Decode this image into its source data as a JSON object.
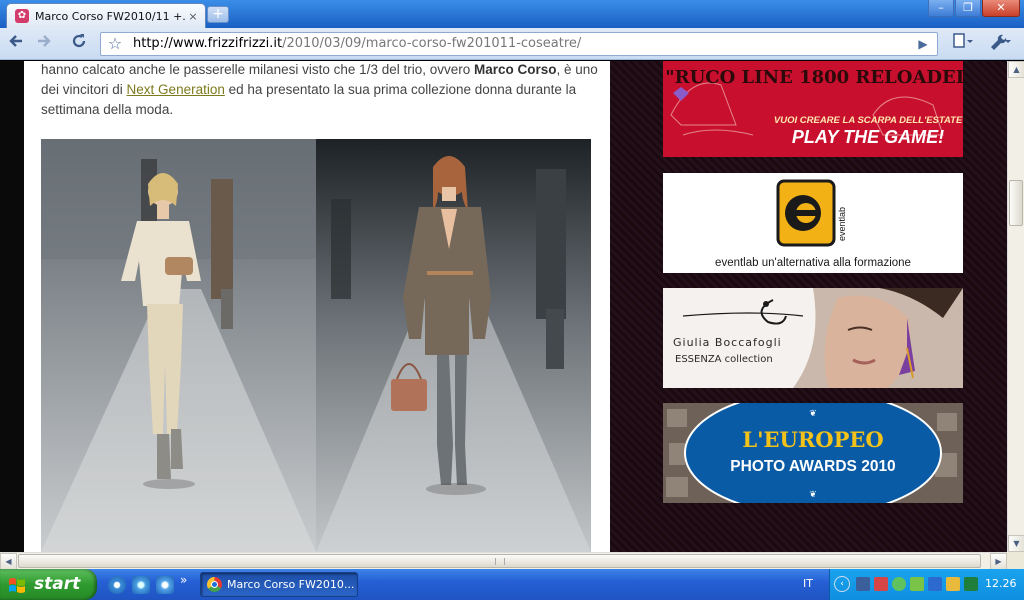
{
  "browser": {
    "tab_title": "Marco Corso FW2010/11 +...",
    "tab_close": "×",
    "new_tab": "+",
    "window_controls": {
      "minimize": "–",
      "maximize": "❐",
      "close": "✕"
    },
    "url_host": "http://www.frizzifrizzi.it",
    "url_path": "/2010/03/09/marco-corso-fw201011-coseatre/",
    "icons": {
      "back": "back-arrow-icon",
      "forward": "forward-arrow-icon",
      "reload": "reload-icon",
      "star": "star-icon",
      "page": "page-menu-icon",
      "tools": "wrench-icon"
    }
  },
  "article": {
    "text_1": "hanno calcato anche le passerelle milanesi visto che 1/3 del trio, ovvero ",
    "bold_name": "Marco Corso",
    "text_2": ", è uno dei vincitori di ",
    "link": "Next Generation",
    "text_3": " ed ha presentato la sua prima collezione donna durante la settimana della moda."
  },
  "sidebar": {
    "ad1": {
      "title": "\"RUCO LINE 1800 RELOADED\"",
      "sub": "VUOI CREARE LA SCARPA DELL'ESTATE?",
      "cta": "PLAY THE GAME!"
    },
    "ad2": {
      "brand": "eventlab",
      "tagline": "eventlab un'alternativa alla formazione"
    },
    "ad3": {
      "name": "Giulia Boccafogli",
      "collection": "ESSENZA collection"
    },
    "ad4": {
      "line1": "L'EUROPEO",
      "line2": "PHOTO AWARDS 2010"
    }
  },
  "taskbar": {
    "start": "start",
    "quick_more": "»",
    "task_button": "Marco Corso FW2010...",
    "lang": "IT",
    "tray_collapse": "‹",
    "clock": "12.26"
  },
  "colors": {
    "accent": "#2660d4",
    "link": "#7d7a1e",
    "ad_red": "#c8102e",
    "ad_blue": "#0a5ba6"
  }
}
